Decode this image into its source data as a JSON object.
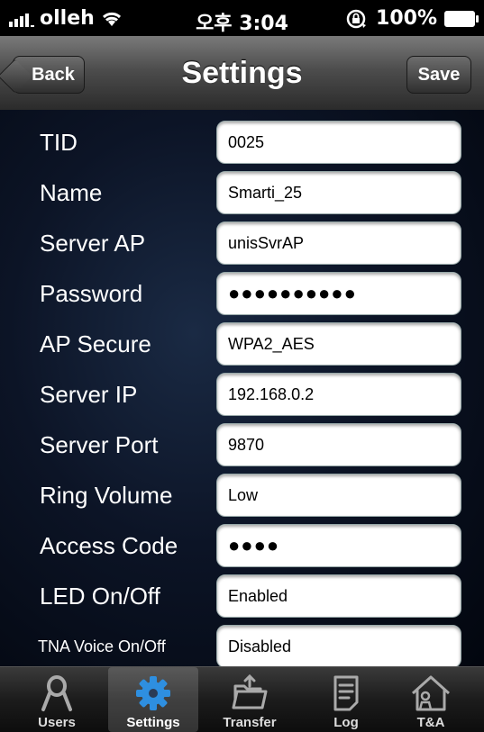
{
  "status_bar": {
    "carrier": "olleh",
    "time": "오후 3:04",
    "battery": "100%"
  },
  "nav": {
    "title": "Settings",
    "back_label": "Back",
    "save_label": "Save"
  },
  "form": {
    "rows": [
      {
        "label": "TID",
        "value": "0025"
      },
      {
        "label": "Name",
        "value": "Smarti_25"
      },
      {
        "label": "Server AP",
        "value": "unisSvrAP"
      },
      {
        "label": "Password",
        "value": "●●●●●●●●●●"
      },
      {
        "label": "AP Secure",
        "value": "WPA2_AES"
      },
      {
        "label": "Server IP",
        "value": "192.168.0.2"
      },
      {
        "label": "Server Port",
        "value": "9870"
      },
      {
        "label": "Ring Volume",
        "value": "Low"
      },
      {
        "label": "Access Code",
        "value": "●●●●"
      },
      {
        "label": "LED On/Off",
        "value": "Enabled"
      },
      {
        "label": "TNA Voice On/Off",
        "value": "Disabled"
      }
    ]
  },
  "tabbar": {
    "items": [
      {
        "label": "Users",
        "icon": "user-icon"
      },
      {
        "label": "Settings",
        "icon": "gear-icon",
        "active": true
      },
      {
        "label": "Transfer",
        "icon": "folder-transfer-icon"
      },
      {
        "label": "Log",
        "icon": "document-icon"
      },
      {
        "label": "T&A",
        "icon": "house-person-icon"
      }
    ]
  },
  "colors": {
    "accent_active_tab": "#ffffff",
    "form_background": "#0c1426",
    "gear_blue": "#2e8fe0"
  }
}
